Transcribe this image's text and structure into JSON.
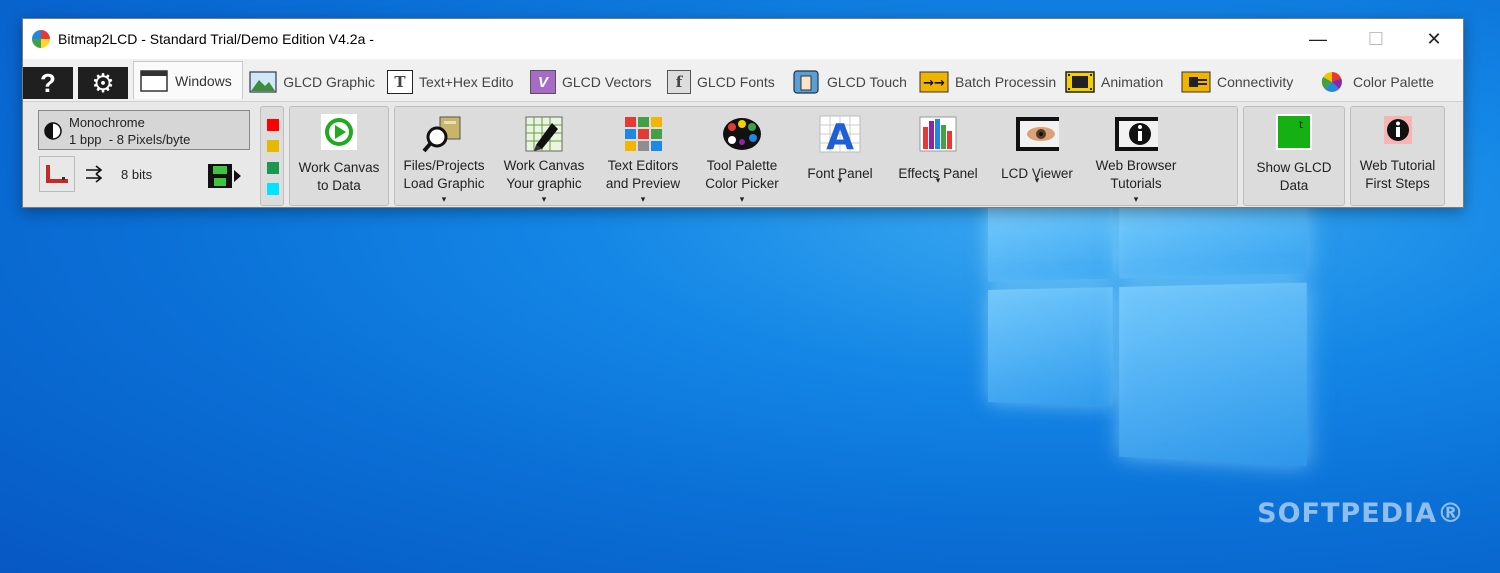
{
  "window": {
    "title": "Bitmap2LCD - Standard Trial/Demo Edition V4.2a -",
    "controls": {
      "minimize": "—",
      "maximize": "☐",
      "close": "✕"
    }
  },
  "tabs": [
    {
      "label": "Windows",
      "icon": "window-icon",
      "active": true
    },
    {
      "label": "GLCD Graphic",
      "icon": "image-icon"
    },
    {
      "label": "Text+Hex Edito",
      "icon": "text-icon"
    },
    {
      "label": "GLCD Vectors",
      "icon": "vector-icon"
    },
    {
      "label": "GLCD Fonts",
      "icon": "font-icon"
    },
    {
      "label": "GLCD Touch",
      "icon": "touch-icon"
    },
    {
      "label": "Batch Processin",
      "icon": "batch-icon"
    },
    {
      "label": "Animation",
      "icon": "film-icon"
    },
    {
      "label": "Connectivity",
      "icon": "plug-icon"
    },
    {
      "label": "Color Palette",
      "icon": "palette-icon"
    }
  ],
  "tab_icon_glyphs": {
    "text": "T",
    "vector": "V",
    "font": "f",
    "help": "?",
    "gear": "⚙"
  },
  "mode_panel": {
    "mode_line1": "Monochrome",
    "mode_line2": "1 bpp  - 8 Pixels/byte",
    "bits": "8 bits"
  },
  "swatch_colors": [
    "#ff0000",
    "#e6b800",
    "#1a9850",
    "#00e5ff"
  ],
  "ribbon": {
    "work_canvas_data": {
      "line1": "Work Canvas",
      "line2": "to Data"
    },
    "buttons": [
      {
        "line1": "Files/Projects",
        "line2": "Load Graphic"
      },
      {
        "line1": "Work Canvas",
        "line2": "Your graphic"
      },
      {
        "line1": "Text Editors",
        "line2": "and Preview"
      },
      {
        "line1": "Tool Palette",
        "line2": "Color Picker"
      },
      {
        "line1": "Font Panel",
        "line2": ""
      },
      {
        "line1": "Effects Panel",
        "line2": ""
      },
      {
        "line1": "LCD Viewer",
        "line2": ""
      },
      {
        "line1": "Web Browser",
        "line2": "Tutorials"
      }
    ],
    "show_glcd": {
      "line1": "Show GLCD",
      "line2": "Data"
    },
    "web_tutorial": {
      "line1": "Web Tutorial",
      "line2": "First Steps"
    },
    "dropdown_glyph": "▾"
  },
  "desktop": {
    "watermark": "SOFTPEDIA®"
  }
}
